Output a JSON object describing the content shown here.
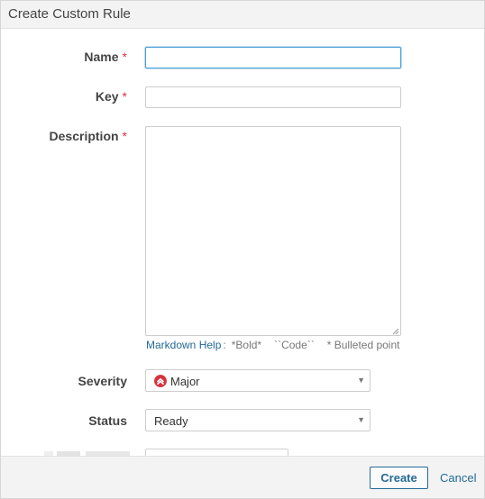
{
  "dialog": {
    "title": "Create Custom Rule"
  },
  "form": {
    "required_marker": "*",
    "name": {
      "label": "Name",
      "value": "",
      "placeholder": ""
    },
    "key": {
      "label": "Key",
      "value": "",
      "placeholder": ""
    },
    "description": {
      "label": "Description",
      "value": ""
    },
    "markdown_help": {
      "link_label": "Markdown Help",
      "separator": ":",
      "items": [
        "*Bold*",
        "``Code``",
        "* Bulleted point"
      ]
    },
    "severity": {
      "label": "Severity",
      "selected": "Major",
      "icon": "major-severity-icon",
      "icon_color": "#d4333f"
    },
    "status": {
      "label": "Status",
      "selected": "Ready"
    }
  },
  "footer": {
    "create_label": "Create",
    "cancel_label": "Cancel"
  },
  "colors": {
    "link": "#236a97",
    "required": "#d4333f",
    "focus": "#4b9fd5"
  }
}
